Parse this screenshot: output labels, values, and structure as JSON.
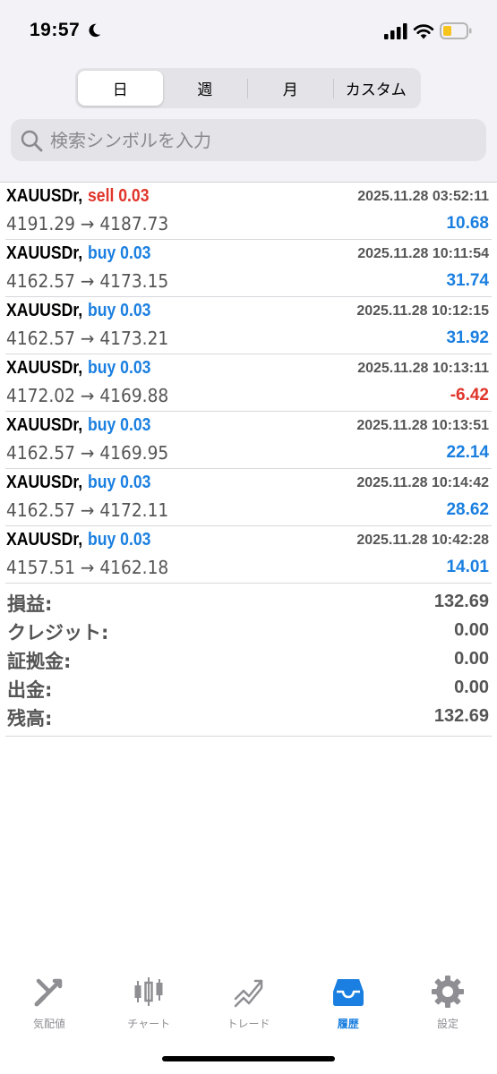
{
  "status_bar": {
    "time": "19:57"
  },
  "segments": [
    "日",
    "週",
    "月",
    "カスタム"
  ],
  "search": {
    "placeholder": "検索シンボルを入力"
  },
  "trades": [
    {
      "symbol": "XAUUSDr,",
      "side": "sell 0.03",
      "side_type": "sell",
      "time": "2025.11.28 03:52:11",
      "prices": "4191.29 → 4187.73",
      "profit": "10.68",
      "profit_type": "pos"
    },
    {
      "symbol": "XAUUSDr,",
      "side": "buy 0.03",
      "side_type": "buy",
      "time": "2025.11.28 10:11:54",
      "prices": "4162.57 → 4173.15",
      "profit": "31.74",
      "profit_type": "pos"
    },
    {
      "symbol": "XAUUSDr,",
      "side": "buy 0.03",
      "side_type": "buy",
      "time": "2025.11.28 10:12:15",
      "prices": "4162.57 → 4173.21",
      "profit": "31.92",
      "profit_type": "pos"
    },
    {
      "symbol": "XAUUSDr,",
      "side": "buy 0.03",
      "side_type": "buy",
      "time": "2025.11.28 10:13:11",
      "prices": "4172.02 → 4169.88",
      "profit": "-6.42",
      "profit_type": "neg"
    },
    {
      "symbol": "XAUUSDr,",
      "side": "buy 0.03",
      "side_type": "buy",
      "time": "2025.11.28 10:13:51",
      "prices": "4162.57 → 4169.95",
      "profit": "22.14",
      "profit_type": "pos"
    },
    {
      "symbol": "XAUUSDr,",
      "side": "buy 0.03",
      "side_type": "buy",
      "time": "2025.11.28 10:14:42",
      "prices": "4162.57 → 4172.11",
      "profit": "28.62",
      "profit_type": "pos"
    },
    {
      "symbol": "XAUUSDr,",
      "side": "buy 0.03",
      "side_type": "buy",
      "time": "2025.11.28 10:42:28",
      "prices": "4157.51 → 4162.18",
      "profit": "14.01",
      "profit_type": "pos"
    }
  ],
  "summary": [
    {
      "label": "損益:",
      "value": "132.69"
    },
    {
      "label": "クレジット:",
      "value": "0.00"
    },
    {
      "label": "証拠金:",
      "value": "0.00"
    },
    {
      "label": "出金:",
      "value": "0.00"
    },
    {
      "label": "残高:",
      "value": "132.69"
    }
  ],
  "tabs": [
    {
      "label": "気配値",
      "icon": "quotes-icon",
      "active": false
    },
    {
      "label": "チャート",
      "icon": "chart-icon",
      "active": false
    },
    {
      "label": "トレード",
      "icon": "trade-icon",
      "active": false
    },
    {
      "label": "履歴",
      "icon": "history-icon",
      "active": true
    },
    {
      "label": "設定",
      "icon": "settings-icon",
      "active": false
    }
  ],
  "colors": {
    "sell": "#e0352b",
    "buy": "#1a7fe0",
    "active_tab": "#1a7fe0",
    "inactive_tab": "#8e8e93",
    "battery": "#f7c31d"
  }
}
